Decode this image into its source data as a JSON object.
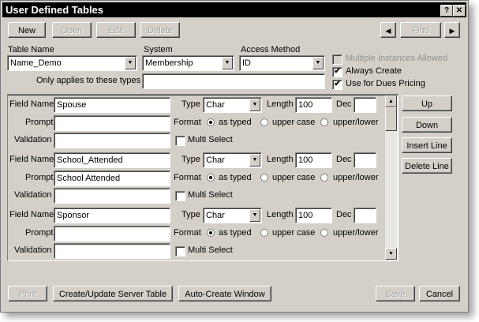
{
  "window": {
    "title": "User Defined Tables"
  },
  "titlebar": {
    "help": "?",
    "close": "✕"
  },
  "toolbar": {
    "new": "New",
    "open": "Open",
    "edit": "Edit",
    "delete": "Delete",
    "prev": "◀",
    "find": "Find",
    "next": "▶"
  },
  "header": {
    "table_name_label": "Table Name",
    "table_name_value": "Name_Demo",
    "system_label": "System",
    "system_value": "Membership",
    "access_label": "Access Method",
    "access_value": "ID",
    "types_label": "Only applies to these types",
    "types_value": ""
  },
  "options": {
    "multiple_instances": {
      "label": "Multiple Instances Allowed",
      "checked": false,
      "enabled": false
    },
    "always_create": {
      "label": "Always Create",
      "checked": true
    },
    "dues_pricing": {
      "label": "Use for Dues Pricing",
      "checked": true
    }
  },
  "field_labels": {
    "field_name": "Field Name",
    "prompt": "Prompt",
    "validation": "Validation",
    "type": "Type",
    "length": "Length",
    "dec": "Dec",
    "format": "Format",
    "as_typed": "as typed",
    "upper_case": "upper case",
    "upper_lower": "upper/lower",
    "multi_select": "Multi Select"
  },
  "fields": [
    {
      "field_name": "Spouse",
      "prompt": "",
      "validation": "",
      "type": "Char",
      "length": "100",
      "dec": "",
      "format": "as typed",
      "multi_select": false
    },
    {
      "field_name": "School_Attended",
      "prompt": "School Attended",
      "validation": "",
      "type": "Char",
      "length": "100",
      "dec": "",
      "format": "as typed",
      "multi_select": false
    },
    {
      "field_name": "Sponsor",
      "prompt": "",
      "validation": "",
      "type": "Char",
      "length": "100",
      "dec": "",
      "format": "as typed",
      "multi_select": false
    }
  ],
  "side_buttons": {
    "up": "Up",
    "down": "Down",
    "insert": "Insert Line",
    "delete": "Delete Line"
  },
  "footer": {
    "print": "Print",
    "create_update": "Create/Update Server Table",
    "auto_create": "Auto-Create Window",
    "save": "Save",
    "cancel": "Cancel"
  }
}
